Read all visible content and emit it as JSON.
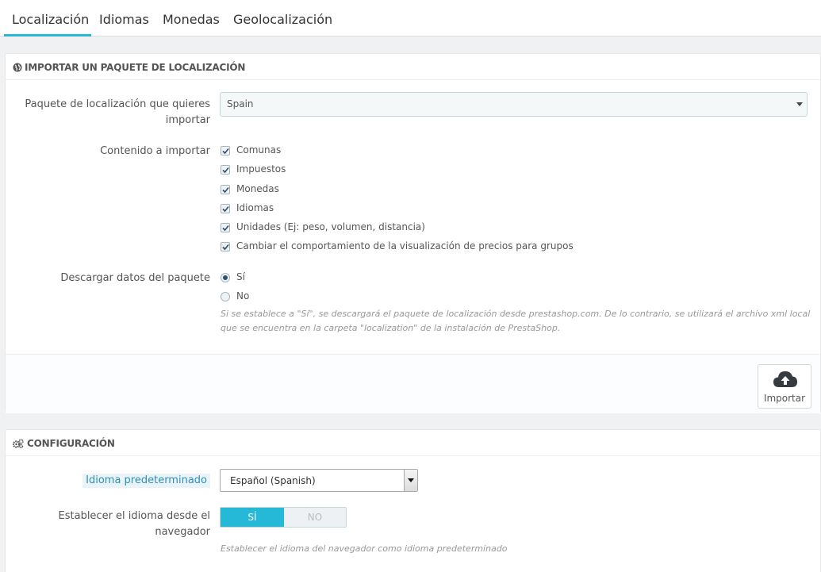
{
  "tabs": [
    {
      "label": "Localización",
      "active": true
    },
    {
      "label": "Idiomas",
      "active": false
    },
    {
      "label": "Monedas",
      "active": false
    },
    {
      "label": "Geolocalización",
      "active": false
    }
  ],
  "import_panel": {
    "title": "IMPORTAR UN PAQUETE DE LOCALIZACIÓN",
    "icon": "globe-icon",
    "package_label": "Paquete de localización que quieres importar",
    "package_label_line1": "Paquete de localización que quieres",
    "package_label_line2": "importar",
    "package_value": "Spain",
    "content_label": "Contenido a importar",
    "content_items": [
      {
        "label": "Comunas",
        "checked": true
      },
      {
        "label": "Impuestos",
        "checked": true
      },
      {
        "label": "Monedas",
        "checked": true
      },
      {
        "label": "Idiomas",
        "checked": true
      },
      {
        "label": "Unidades (Ej: peso, volumen, distancia)",
        "checked": true
      },
      {
        "label": "Cambiar el comportamiento de la visualización de precios para grupos",
        "checked": true
      }
    ],
    "download_label": "Descargar datos del paquete",
    "download_options": [
      {
        "label": "Sí",
        "checked": true
      },
      {
        "label": "No",
        "checked": false
      }
    ],
    "download_help_line1": "Si se establece a \"Sí\", se descargará el paquete de localización desde prestashop.com. De lo contrario, se utilizará el archivo xml local",
    "download_help_line2": "que se encuentra en la carpeta \"localization\" de la instalación de PrestaShop.",
    "import_button": "Importar"
  },
  "config_panel": {
    "title": "CONFIGURACIÓN",
    "icon": "gears-icon",
    "default_lang_label": "Idioma predeterminado",
    "default_lang_value": "Español (Spanish)",
    "browser_lang_label_line1": "Establecer el idioma desde el",
    "browser_lang_label_line2": "navegador",
    "toggle_yes": "SÍ",
    "toggle_no": "NO",
    "browser_lang_help": "Establecer el idioma del navegador como idioma predeterminado"
  },
  "colors": {
    "accent": "#25b9d7",
    "background": "#eff1f2"
  }
}
